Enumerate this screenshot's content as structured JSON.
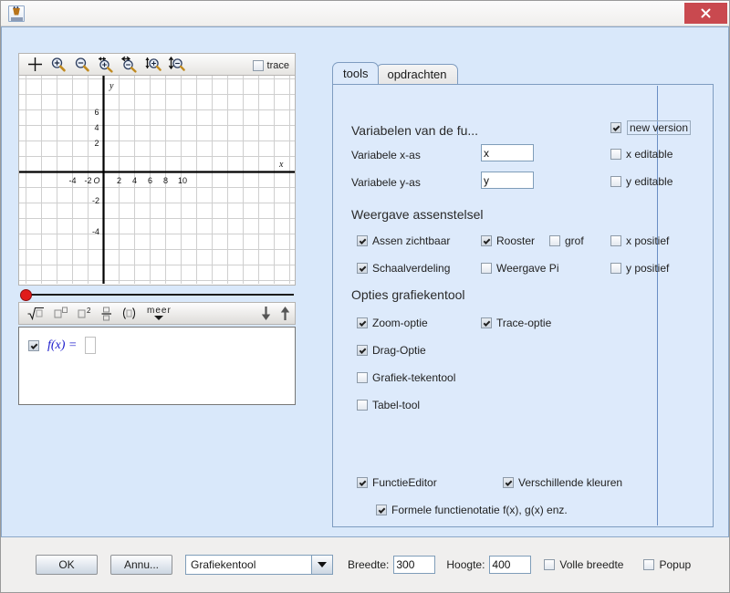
{
  "window": {
    "app_icon": "java-icon",
    "close_label": "✕"
  },
  "graph_toolbar": {
    "tools": [
      {
        "name": "move-tool",
        "icon": "plus-icon"
      },
      {
        "name": "zoom-in-tool",
        "icon": "zoom-in-icon"
      },
      {
        "name": "zoom-out-tool",
        "icon": "zoom-out-icon"
      },
      {
        "name": "horizontal-zoom-in-tool",
        "icon": "horizontal-zoom-in-icon"
      },
      {
        "name": "horizontal-zoom-out-tool",
        "icon": "horizontal-zoom-out-icon"
      },
      {
        "name": "vertical-zoom-in-tool",
        "icon": "vertical-zoom-in-icon"
      },
      {
        "name": "vertical-zoom-out-tool",
        "icon": "vertical-zoom-out-icon"
      }
    ],
    "trace_label": "trace",
    "trace_checked": false
  },
  "graph": {
    "x_axis_label": "x",
    "y_axis_label": "y",
    "origin_label": "O",
    "x_ticks": [
      "-4",
      "-2",
      "2",
      "4",
      "6",
      "8",
      "10"
    ],
    "y_ticks": [
      "6",
      "4",
      "2",
      "-2",
      "-4"
    ],
    "grid": true
  },
  "formula_toolbar": {
    "buttons": [
      {
        "name": "sqrt-button",
        "icon": "sqrt-icon"
      },
      {
        "name": "power-button",
        "icon": "superscript-icon"
      },
      {
        "name": "square-button",
        "icon": "square-icon"
      },
      {
        "name": "fraction-button",
        "icon": "fraction-icon"
      },
      {
        "name": "parentheses-button",
        "icon": "parentheses-icon"
      }
    ],
    "more_label": "meer",
    "down_arrow": "down-arrow-icon",
    "up_arrow": "up-arrow-icon"
  },
  "function_editor": {
    "row_checked": true,
    "function_label": "f(x) =",
    "function_value": ""
  },
  "tabs": [
    {
      "label": "tools",
      "active": true
    },
    {
      "label": "opdrachten",
      "active": false
    }
  ],
  "tools_panel": {
    "section_variables": "Variabelen van de fu...",
    "var_x_label": "Variabele x-as",
    "var_x_value": "x",
    "var_y_label": "Variabele y-as",
    "var_y_value": "y",
    "new_version_label": "new version",
    "new_version_checked": true,
    "x_editable_label": "x editable",
    "x_editable_checked": false,
    "y_editable_label": "y editable",
    "y_editable_checked": false,
    "section_axes": "Weergave assenstelsel",
    "assen_zichtbaar_label": "Assen zichtbaar",
    "assen_zichtbaar_checked": true,
    "rooster_label": "Rooster",
    "rooster_checked": true,
    "grof_label": "grof",
    "grof_checked": false,
    "x_positief_label": "x positief",
    "x_positief_checked": false,
    "schaalverdeling_label": "Schaalverdeling",
    "schaalverdeling_checked": true,
    "weergave_pi_label": "Weergave Pi",
    "weergave_pi_checked": false,
    "y_positief_label": "y positief",
    "y_positief_checked": false,
    "section_options": "Opties grafiekentool",
    "zoom_optie_label": "Zoom-optie",
    "zoom_optie_checked": true,
    "trace_optie_label": "Trace-optie",
    "trace_optie_checked": true,
    "drag_optie_label": "Drag-Optie",
    "drag_optie_checked": true,
    "grafiek_tekentool_label": "Grafiek-tekentool",
    "grafiek_tekentool_checked": false,
    "tabel_tool_label": "Tabel-tool",
    "tabel_tool_checked": false,
    "functie_editor_label": "FunctieEditor",
    "functie_editor_checked": true,
    "verschillende_kleuren_label": "Verschillende kleuren",
    "verschillende_kleuren_checked": true,
    "formele_notatie_label": "Formele functienotatie f(x), g(x) enz.",
    "formele_notatie_checked": true
  },
  "footer": {
    "ok_label": "OK",
    "cancel_label": "Annu...",
    "tool_select_value": "Grafiekentool",
    "breedte_label": "Breedte:",
    "breedte_value": "300",
    "hoogte_label": "Hoogte:",
    "hoogte_value": "400",
    "volle_breedte_label": "Volle breedte",
    "volle_breedte_checked": false,
    "popup_label": "Popup",
    "popup_checked": false
  },
  "colors": {
    "panel_blue": "#ddeafb",
    "content_blue": "#d9e8fa",
    "close_red": "#c9494f",
    "accent_blue": "#1c1ccc",
    "slider_red": "#e01b1b"
  }
}
